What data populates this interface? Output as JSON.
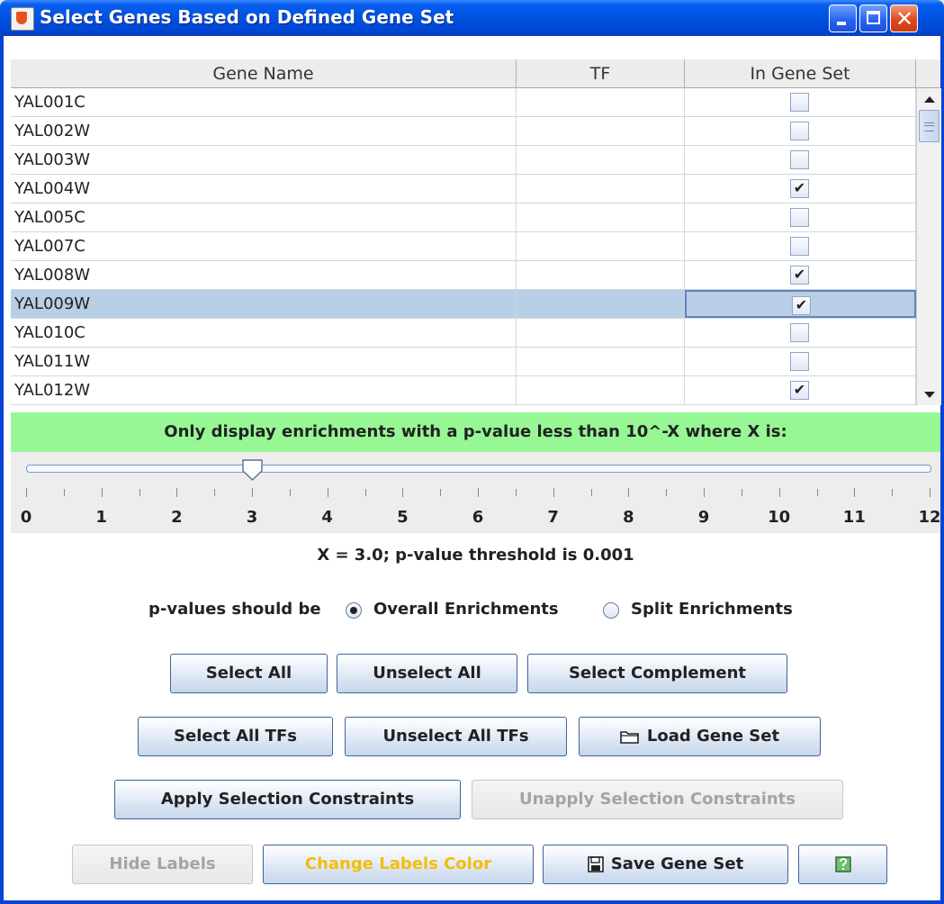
{
  "window": {
    "title": "Select Genes Based on Defined Gene Set"
  },
  "table": {
    "columns": [
      "Gene Name",
      "TF",
      "In Gene Set"
    ],
    "rows": [
      {
        "name": "YAL001C",
        "tf": "",
        "checked": false
      },
      {
        "name": "YAL002W",
        "tf": "",
        "checked": false
      },
      {
        "name": "YAL003W",
        "tf": "",
        "checked": false
      },
      {
        "name": "YAL004W",
        "tf": "",
        "checked": true
      },
      {
        "name": "YAL005C",
        "tf": "",
        "checked": false
      },
      {
        "name": "YAL007C",
        "tf": "",
        "checked": false
      },
      {
        "name": "YAL008W",
        "tf": "",
        "checked": true
      },
      {
        "name": "YAL009W",
        "tf": "",
        "checked": true,
        "selected": true
      },
      {
        "name": "YAL010C",
        "tf": "",
        "checked": false
      },
      {
        "name": "YAL011W",
        "tf": "",
        "checked": false
      },
      {
        "name": "YAL012W",
        "tf": "",
        "checked": true
      }
    ]
  },
  "filter": {
    "banner": "Only display enrichments with a p-value less than 10^-X where X is:",
    "slider": {
      "min": 0,
      "max": 12,
      "value": 3.0,
      "labels": [
        "0",
        "1",
        "2",
        "3",
        "4",
        "5",
        "6",
        "7",
        "8",
        "9",
        "10",
        "11",
        "12"
      ]
    },
    "summary": "X = 3.0; p-value threshold is 0.001"
  },
  "pvalues": {
    "label": "p-values should be",
    "options": [
      "Overall Enrichments",
      "Split Enrichments"
    ],
    "selected": "Overall Enrichments"
  },
  "buttons": {
    "select_all": "Select All",
    "unselect_all": "Unselect All",
    "select_complement": "Select Complement",
    "select_all_tfs": "Select All TFs",
    "unselect_all_tfs": "Unselect All TFs",
    "load_gene_set": "Load Gene Set",
    "apply_constraints": "Apply  Selection Constraints",
    "unapply_constraints": "Unapply  Selection Constraints",
    "hide_labels": "Hide Labels",
    "change_labels_color": "Change Labels Color",
    "save_gene_set": "Save Gene Set"
  },
  "colors": {
    "banner": "#97f795",
    "labels_color": "#f5bd0a",
    "selection": "#b8cfe5",
    "title_bar": "#0054e3"
  },
  "icons": {
    "load": "folder-icon",
    "save": "floppy-icon",
    "help": "help-icon",
    "app": "java-cup-icon"
  }
}
